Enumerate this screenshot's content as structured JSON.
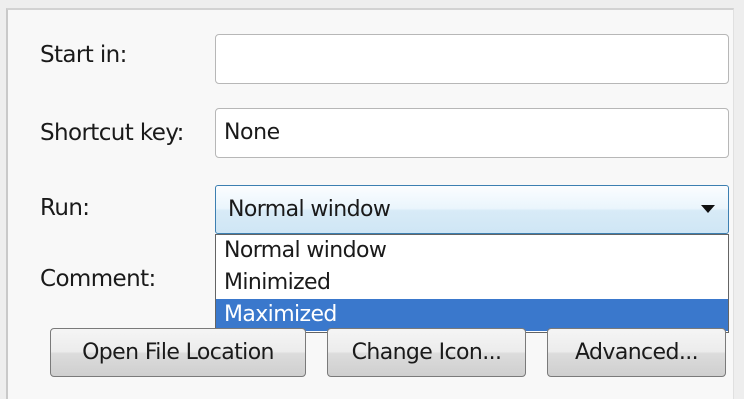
{
  "form": {
    "start_in": {
      "label": "Start in:",
      "value": ""
    },
    "shortcut_key": {
      "label": "Shortcut key:",
      "value": "None"
    },
    "run": {
      "label": "Run:",
      "selected": "Normal window",
      "options": [
        "Normal window",
        "Minimized",
        "Maximized"
      ],
      "highlighted_option": "Maximized"
    },
    "comment": {
      "label": "Comment:"
    }
  },
  "buttons": {
    "open_file_location": "Open File Location",
    "change_icon": "Change Icon...",
    "advanced": "Advanced..."
  },
  "colors": {
    "highlight": "#3a78cc",
    "combo_border": "#3c7fb1"
  },
  "icons": {
    "combo_arrow": "chevron-down-icon"
  }
}
